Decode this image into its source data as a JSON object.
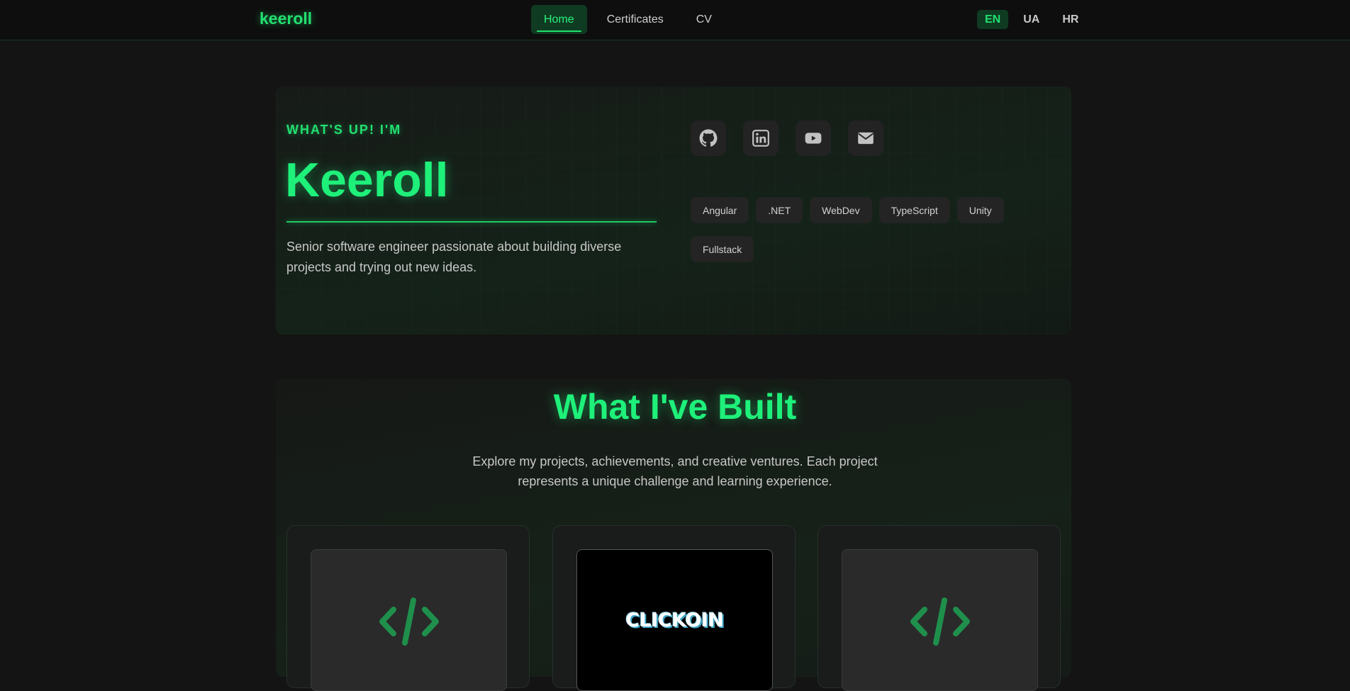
{
  "navbar": {
    "logo": "keeroll",
    "links": [
      {
        "label": "Home",
        "active": true
      },
      {
        "label": "Certificates",
        "active": false
      },
      {
        "label": "CV",
        "active": false
      }
    ],
    "languages": [
      {
        "label": "EN",
        "active": true
      },
      {
        "label": "UA",
        "active": false
      },
      {
        "label": "HR",
        "active": false
      }
    ]
  },
  "hero": {
    "eyebrow": "WHAT'S UP! I'M",
    "name": "Keeroll",
    "description": "Senior software engineer passionate about building diverse projects and trying out new ideas.",
    "socials": [
      {
        "icon": "github-icon"
      },
      {
        "icon": "linkedin-icon"
      },
      {
        "icon": "youtube-icon"
      },
      {
        "icon": "email-icon"
      }
    ],
    "tags": [
      "Angular",
      ".NET",
      "WebDev",
      "TypeScript",
      "Unity",
      "Fullstack"
    ]
  },
  "projects": {
    "title": "What I've Built",
    "subtitle": "Explore my projects, achievements, and creative ventures. Each project represents a unique challenge and learning experience.",
    "cards": [
      {
        "thumb": "code-icon"
      },
      {
        "thumb": "clickoin-logo",
        "logo_text": "CLICKOIN"
      },
      {
        "thumb": "code-icon"
      }
    ]
  },
  "colors": {
    "accent": "#22e070",
    "background": "#141414",
    "navbar": "#0e0e0e",
    "active_bg": "#0f3b22"
  }
}
